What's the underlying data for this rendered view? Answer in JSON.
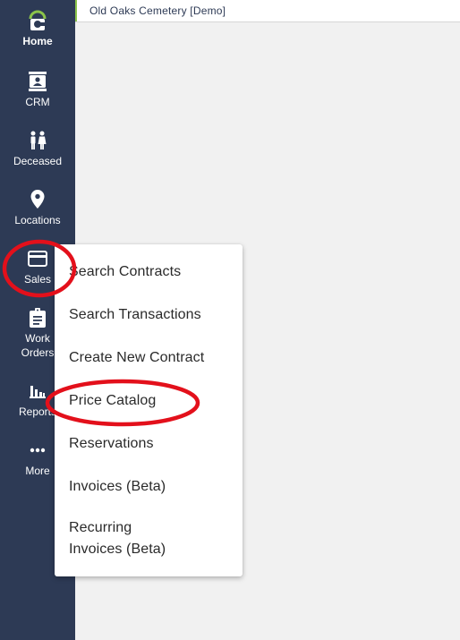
{
  "app": {
    "title": "Old Oaks Cemetery [Demo]",
    "accent_color": "#8bc34a",
    "sidebar_color": "#2d3a55",
    "annotation_color": "#e3101b"
  },
  "sidebar": {
    "items": [
      {
        "label": "Home",
        "icon": "logo-icon"
      },
      {
        "label": "CRM",
        "icon": "contact-card-icon"
      },
      {
        "label": "Deceased",
        "icon": "people-icon"
      },
      {
        "label": "Locations",
        "icon": "map-pin-icon"
      },
      {
        "label": "Sales",
        "icon": "credit-card-icon"
      },
      {
        "label": "Work Orders",
        "icon": "clipboard-icon"
      },
      {
        "label": "Reports",
        "icon": "bar-chart-icon"
      },
      {
        "label": "More",
        "icon": "more-dots-icon"
      }
    ]
  },
  "sales_menu": {
    "items": [
      "Search Contracts",
      "Search Transactions",
      "Create New Contract",
      "Price Catalog",
      "Reservations",
      "Invoices (Beta)",
      "Recurring Invoices (Beta)"
    ]
  }
}
